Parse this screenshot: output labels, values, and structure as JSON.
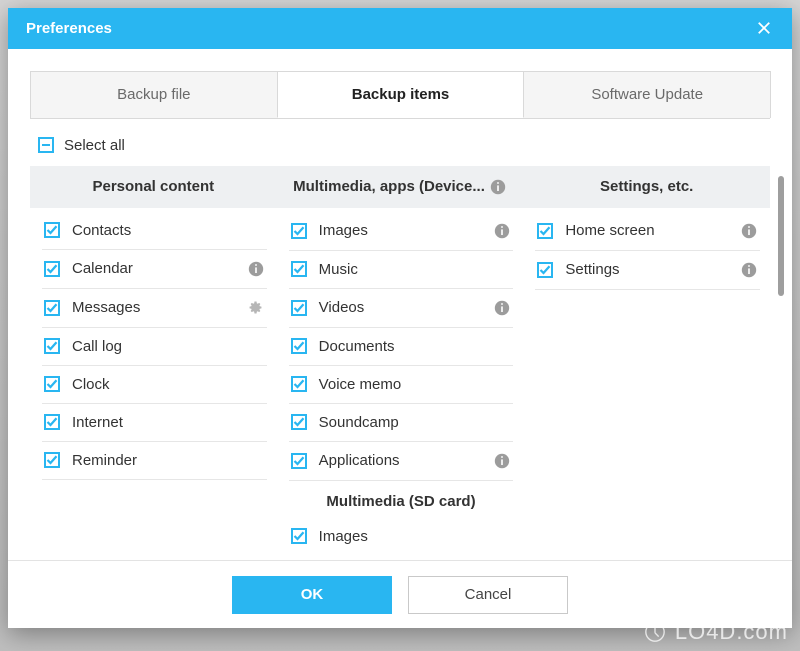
{
  "window": {
    "title": "Preferences"
  },
  "tabs": {
    "backup_file": "Backup file",
    "backup_items": "Backup items",
    "software_update": "Software Update"
  },
  "select_all": {
    "label": "Select all"
  },
  "columns": {
    "personal": {
      "header": "Personal content",
      "items": [
        {
          "label": "Contacts",
          "checked": true
        },
        {
          "label": "Calendar",
          "checked": true,
          "info": true
        },
        {
          "label": "Messages",
          "checked": true,
          "gear": true
        },
        {
          "label": "Call log",
          "checked": true
        },
        {
          "label": "Clock",
          "checked": true
        },
        {
          "label": "Internet",
          "checked": true
        },
        {
          "label": "Reminder",
          "checked": true
        }
      ]
    },
    "multimedia": {
      "header": "Multimedia, apps (Device...",
      "items": [
        {
          "label": "Images",
          "checked": true,
          "info": true
        },
        {
          "label": "Music",
          "checked": true
        },
        {
          "label": "Videos",
          "checked": true,
          "info": true
        },
        {
          "label": "Documents",
          "checked": true
        },
        {
          "label": "Voice memo",
          "checked": true
        },
        {
          "label": "Soundcamp",
          "checked": true
        },
        {
          "label": "Applications",
          "checked": true,
          "info": true
        }
      ],
      "subheader": "Multimedia (SD card)",
      "sd_items": [
        {
          "label": "Images",
          "checked": true
        }
      ]
    },
    "settings": {
      "header": "Settings, etc.",
      "items": [
        {
          "label": "Home screen",
          "checked": true,
          "info": true
        },
        {
          "label": "Settings",
          "checked": true,
          "info": true
        }
      ]
    }
  },
  "buttons": {
    "ok": "OK",
    "cancel": "Cancel"
  },
  "watermark": "LO4D.com"
}
